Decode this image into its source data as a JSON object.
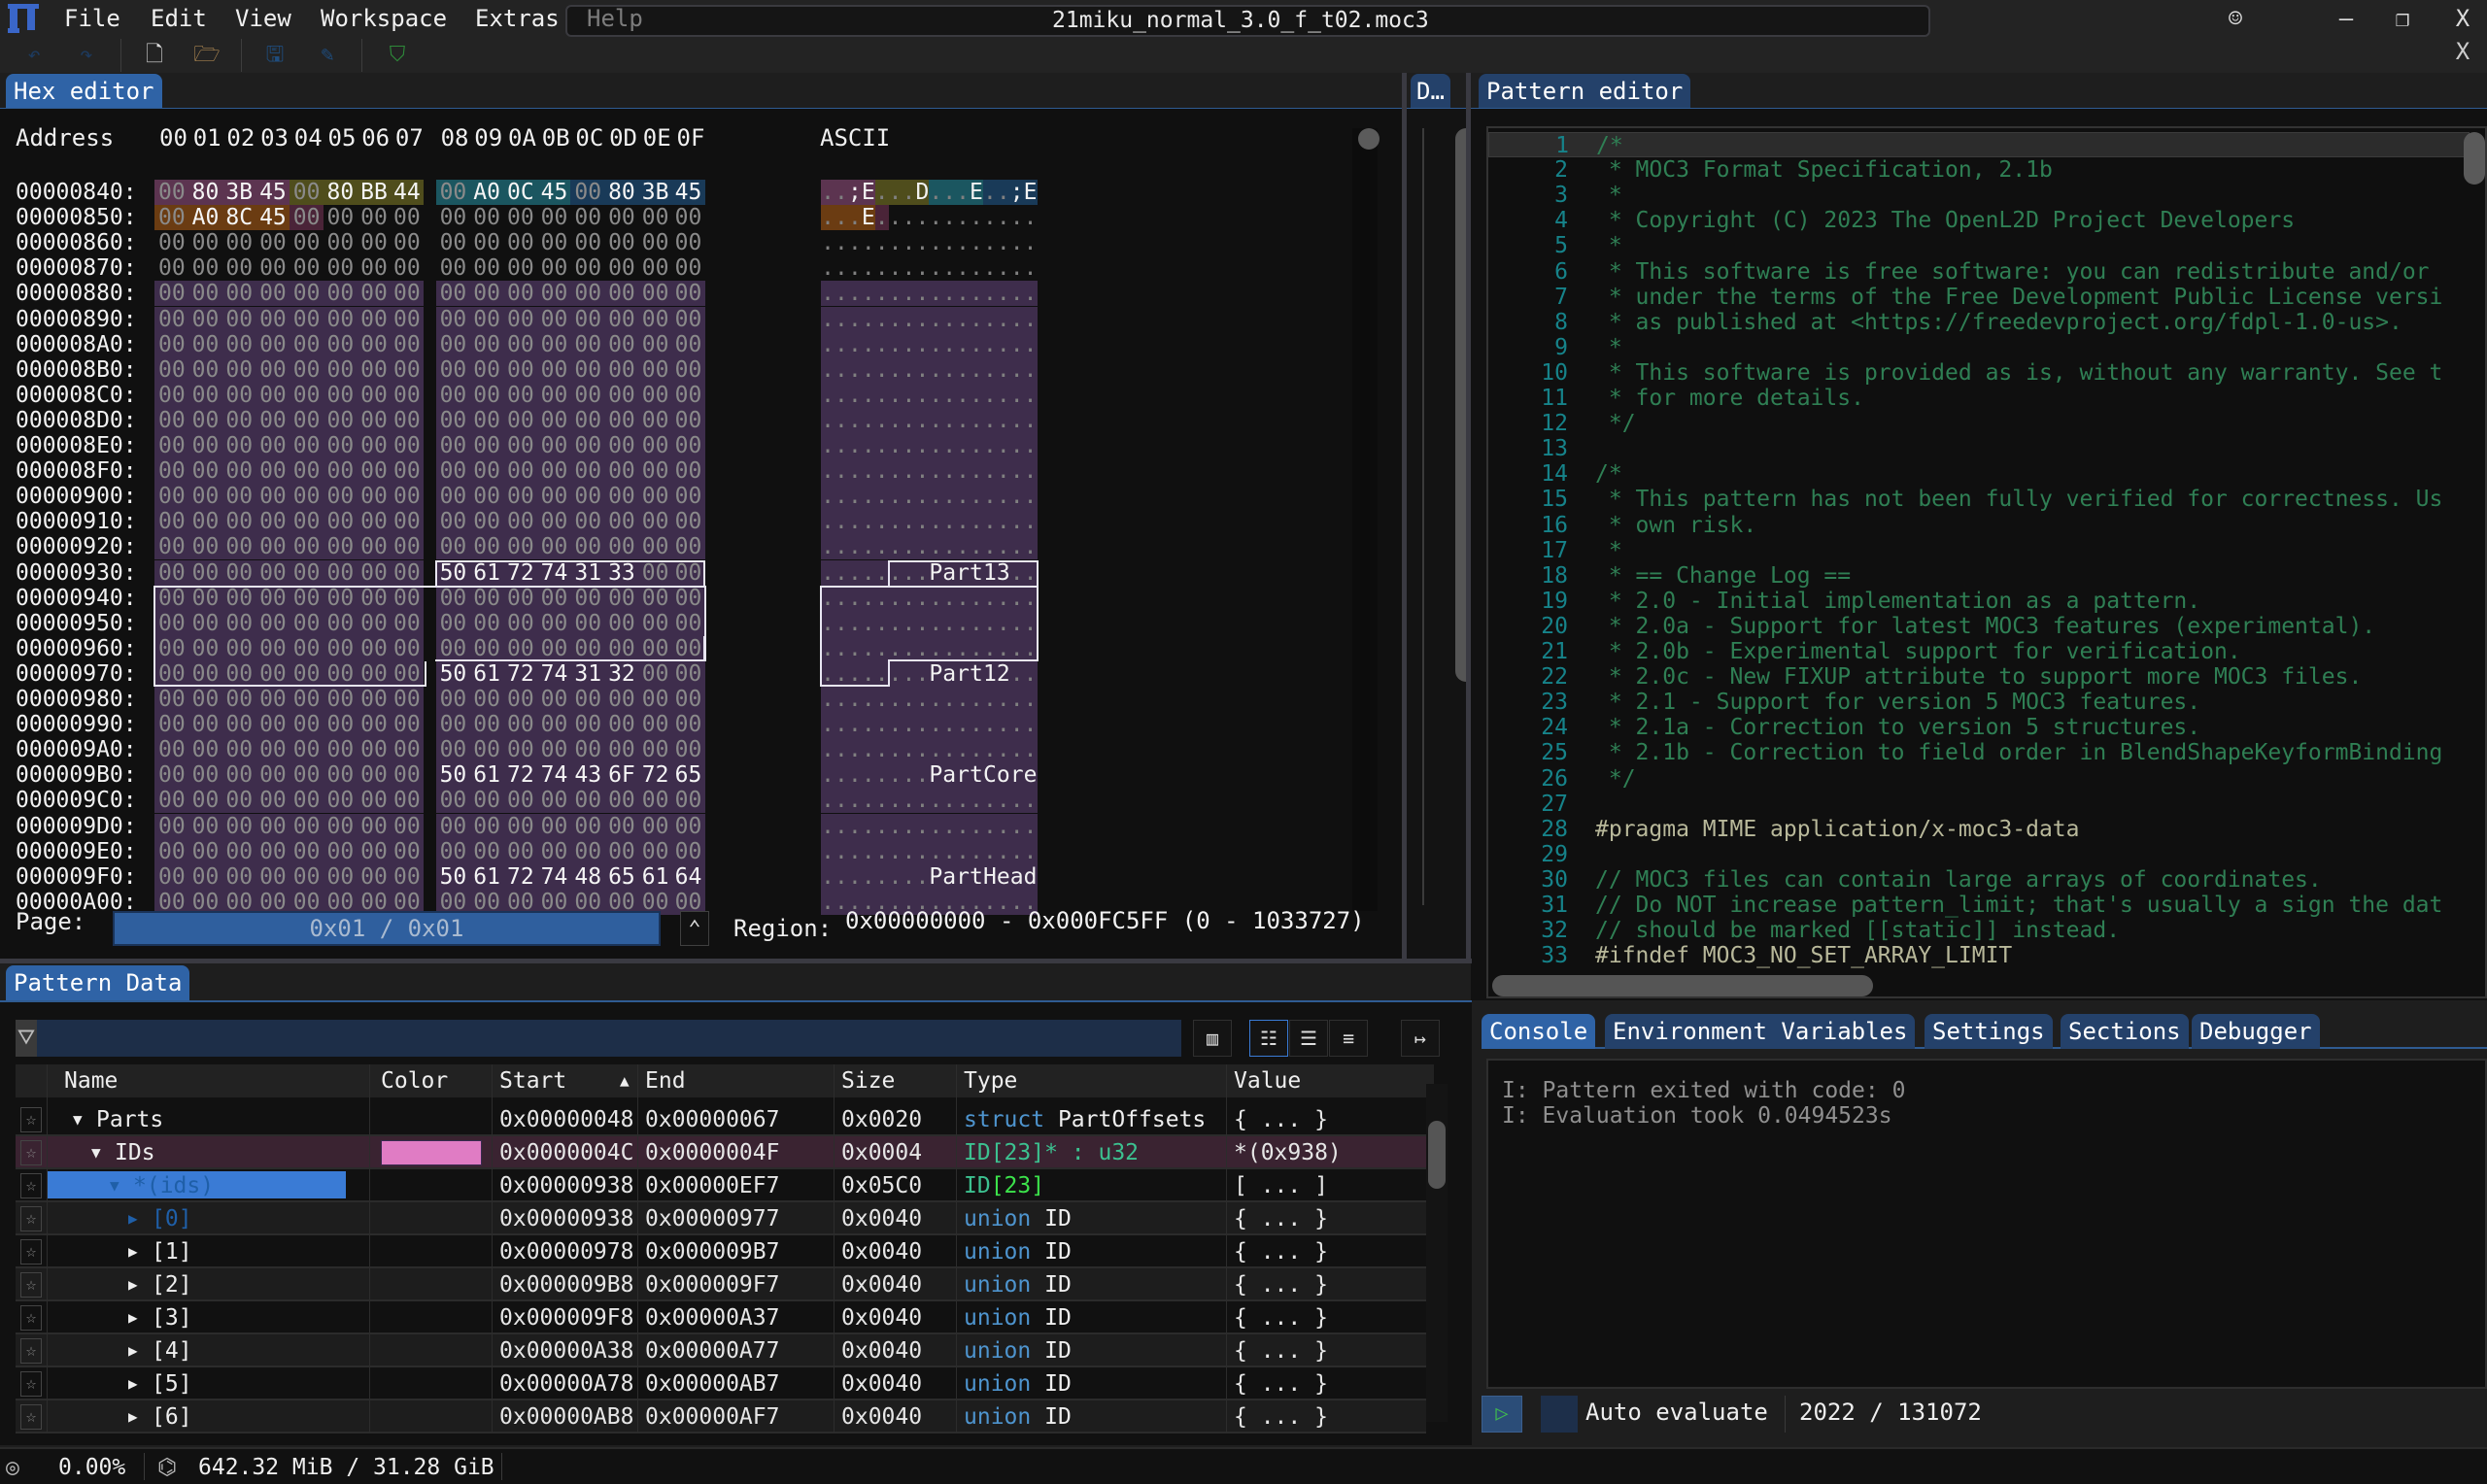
{
  "app": {
    "menu": [
      "File",
      "Edit",
      "View",
      "Workspace",
      "Extras",
      "Help"
    ],
    "file_title": "21miku_normal_3.0_f_t02.moc3",
    "window_buttons": {
      "feedback": "☺",
      "minimize": "–",
      "restore": "❐",
      "close": "X",
      "close_tab": "X"
    }
  },
  "toolbar": {
    "icons": [
      "undo-icon",
      "redo-icon",
      "new-file-icon",
      "open-folder-icon",
      "save-icon",
      "save-as-icon",
      "bookmark-icon"
    ]
  },
  "tabs": {
    "hex_editor": "Hex editor",
    "data_inspector": "D…",
    "pattern_editor": "Pattern editor",
    "pattern_data": "Pattern Data",
    "console_tabs": [
      "Console",
      "Environment Variables",
      "Settings",
      "Sections",
      "Debugger"
    ]
  },
  "hex": {
    "header_address": "Address",
    "header_cols": [
      "00",
      "01",
      "02",
      "03",
      "04",
      "05",
      "06",
      "07",
      "08",
      "09",
      "0A",
      "0B",
      "0C",
      "0D",
      "0E",
      "0F"
    ],
    "header_ascii": "ASCII",
    "rows": [
      {
        "addr": "00000840:",
        "bytes": [
          "00",
          "80",
          "3B",
          "45",
          "00",
          "80",
          "BB",
          "44",
          "00",
          "A0",
          "0C",
          "45",
          "00",
          "80",
          "3B",
          "45"
        ],
        "ascii": "..;E...D...E..;E"
      },
      {
        "addr": "00000850:",
        "bytes": [
          "00",
          "A0",
          "8C",
          "45",
          "00",
          "00",
          "00",
          "00",
          "00",
          "00",
          "00",
          "00",
          "00",
          "00",
          "00",
          "00"
        ],
        "ascii": "...E............"
      },
      {
        "addr": "00000860:",
        "bytes": [
          "00",
          "00",
          "00",
          "00",
          "00",
          "00",
          "00",
          "00",
          "00",
          "00",
          "00",
          "00",
          "00",
          "00",
          "00",
          "00"
        ],
        "ascii": "................"
      },
      {
        "addr": "00000870:",
        "bytes": [
          "00",
          "00",
          "00",
          "00",
          "00",
          "00",
          "00",
          "00",
          "00",
          "00",
          "00",
          "00",
          "00",
          "00",
          "00",
          "00"
        ],
        "ascii": "................"
      },
      {
        "addr": "00000880:",
        "bytes": [
          "00",
          "00",
          "00",
          "00",
          "00",
          "00",
          "00",
          "00",
          "00",
          "00",
          "00",
          "00",
          "00",
          "00",
          "00",
          "00"
        ],
        "ascii": "................"
      },
      {
        "addr": "00000890:",
        "bytes": [
          "00",
          "00",
          "00",
          "00",
          "00",
          "00",
          "00",
          "00",
          "00",
          "00",
          "00",
          "00",
          "00",
          "00",
          "00",
          "00"
        ],
        "ascii": "................"
      },
      {
        "addr": "000008A0:",
        "bytes": [
          "00",
          "00",
          "00",
          "00",
          "00",
          "00",
          "00",
          "00",
          "00",
          "00",
          "00",
          "00",
          "00",
          "00",
          "00",
          "00"
        ],
        "ascii": "................"
      },
      {
        "addr": "000008B0:",
        "bytes": [
          "00",
          "00",
          "00",
          "00",
          "00",
          "00",
          "00",
          "00",
          "00",
          "00",
          "00",
          "00",
          "00",
          "00",
          "00",
          "00"
        ],
        "ascii": "................"
      },
      {
        "addr": "000008C0:",
        "bytes": [
          "00",
          "00",
          "00",
          "00",
          "00",
          "00",
          "00",
          "00",
          "00",
          "00",
          "00",
          "00",
          "00",
          "00",
          "00",
          "00"
        ],
        "ascii": "................"
      },
      {
        "addr": "000008D0:",
        "bytes": [
          "00",
          "00",
          "00",
          "00",
          "00",
          "00",
          "00",
          "00",
          "00",
          "00",
          "00",
          "00",
          "00",
          "00",
          "00",
          "00"
        ],
        "ascii": "................"
      },
      {
        "addr": "000008E0:",
        "bytes": [
          "00",
          "00",
          "00",
          "00",
          "00",
          "00",
          "00",
          "00",
          "00",
          "00",
          "00",
          "00",
          "00",
          "00",
          "00",
          "00"
        ],
        "ascii": "................"
      },
      {
        "addr": "000008F0:",
        "bytes": [
          "00",
          "00",
          "00",
          "00",
          "00",
          "00",
          "00",
          "00",
          "00",
          "00",
          "00",
          "00",
          "00",
          "00",
          "00",
          "00"
        ],
        "ascii": "................"
      },
      {
        "addr": "00000900:",
        "bytes": [
          "00",
          "00",
          "00",
          "00",
          "00",
          "00",
          "00",
          "00",
          "00",
          "00",
          "00",
          "00",
          "00",
          "00",
          "00",
          "00"
        ],
        "ascii": "................"
      },
      {
        "addr": "00000910:",
        "bytes": [
          "00",
          "00",
          "00",
          "00",
          "00",
          "00",
          "00",
          "00",
          "00",
          "00",
          "00",
          "00",
          "00",
          "00",
          "00",
          "00"
        ],
        "ascii": "................"
      },
      {
        "addr": "00000920:",
        "bytes": [
          "00",
          "00",
          "00",
          "00",
          "00",
          "00",
          "00",
          "00",
          "00",
          "00",
          "00",
          "00",
          "00",
          "00",
          "00",
          "00"
        ],
        "ascii": "................"
      },
      {
        "addr": "00000930:",
        "bytes": [
          "00",
          "00",
          "00",
          "00",
          "00",
          "00",
          "00",
          "00",
          "50",
          "61",
          "72",
          "74",
          "31",
          "33",
          "00",
          "00"
        ],
        "ascii": "........Part13.."
      },
      {
        "addr": "00000940:",
        "bytes": [
          "00",
          "00",
          "00",
          "00",
          "00",
          "00",
          "00",
          "00",
          "00",
          "00",
          "00",
          "00",
          "00",
          "00",
          "00",
          "00"
        ],
        "ascii": "................"
      },
      {
        "addr": "00000950:",
        "bytes": [
          "00",
          "00",
          "00",
          "00",
          "00",
          "00",
          "00",
          "00",
          "00",
          "00",
          "00",
          "00",
          "00",
          "00",
          "00",
          "00"
        ],
        "ascii": "................"
      },
      {
        "addr": "00000960:",
        "bytes": [
          "00",
          "00",
          "00",
          "00",
          "00",
          "00",
          "00",
          "00",
          "00",
          "00",
          "00",
          "00",
          "00",
          "00",
          "00",
          "00"
        ],
        "ascii": "................"
      },
      {
        "addr": "00000970:",
        "bytes": [
          "00",
          "00",
          "00",
          "00",
          "00",
          "00",
          "00",
          "00",
          "50",
          "61",
          "72",
          "74",
          "31",
          "32",
          "00",
          "00"
        ],
        "ascii": "........Part12.."
      },
      {
        "addr": "00000980:",
        "bytes": [
          "00",
          "00",
          "00",
          "00",
          "00",
          "00",
          "00",
          "00",
          "00",
          "00",
          "00",
          "00",
          "00",
          "00",
          "00",
          "00"
        ],
        "ascii": "................"
      },
      {
        "addr": "00000990:",
        "bytes": [
          "00",
          "00",
          "00",
          "00",
          "00",
          "00",
          "00",
          "00",
          "00",
          "00",
          "00",
          "00",
          "00",
          "00",
          "00",
          "00"
        ],
        "ascii": "................"
      },
      {
        "addr": "000009A0:",
        "bytes": [
          "00",
          "00",
          "00",
          "00",
          "00",
          "00",
          "00",
          "00",
          "00",
          "00",
          "00",
          "00",
          "00",
          "00",
          "00",
          "00"
        ],
        "ascii": "................"
      },
      {
        "addr": "000009B0:",
        "bytes": [
          "00",
          "00",
          "00",
          "00",
          "00",
          "00",
          "00",
          "00",
          "50",
          "61",
          "72",
          "74",
          "43",
          "6F",
          "72",
          "65"
        ],
        "ascii": "........PartCore"
      },
      {
        "addr": "000009C0:",
        "bytes": [
          "00",
          "00",
          "00",
          "00",
          "00",
          "00",
          "00",
          "00",
          "00",
          "00",
          "00",
          "00",
          "00",
          "00",
          "00",
          "00"
        ],
        "ascii": "................"
      },
      {
        "addr": "000009D0:",
        "bytes": [
          "00",
          "00",
          "00",
          "00",
          "00",
          "00",
          "00",
          "00",
          "00",
          "00",
          "00",
          "00",
          "00",
          "00",
          "00",
          "00"
        ],
        "ascii": "................"
      },
      {
        "addr": "000009E0:",
        "bytes": [
          "00",
          "00",
          "00",
          "00",
          "00",
          "00",
          "00",
          "00",
          "00",
          "00",
          "00",
          "00",
          "00",
          "00",
          "00",
          "00"
        ],
        "ascii": "................"
      },
      {
        "addr": "000009F0:",
        "bytes": [
          "00",
          "00",
          "00",
          "00",
          "00",
          "00",
          "00",
          "00",
          "50",
          "61",
          "72",
          "74",
          "48",
          "65",
          "61",
          "64"
        ],
        "ascii": "........PartHead"
      },
      {
        "addr": "00000A00:",
        "bytes": [
          "00",
          "00",
          "00",
          "00",
          "00",
          "00",
          "00",
          "00",
          "00",
          "00",
          "00",
          "00",
          "00",
          "00",
          "00",
          "00"
        ],
        "ascii": "................"
      }
    ],
    "highlight_colors": {
      "pink": "#5c3450",
      "olive": "#4f4d1c",
      "teal": "#1b5660",
      "navy": "#193a58",
      "orange": "#6b3c12",
      "maroon": "#4a2438",
      "purple": "#3e2d4c"
    },
    "page_label": "Page:",
    "page_value": "0x01 / 0x01",
    "region_label": "Region:",
    "region_value": "0x00000000 - 0x000FC5FF (0 - 1033727)"
  },
  "pattern_editor": {
    "lines": [
      {
        "n": "1",
        "t": "/*",
        "c": "comment"
      },
      {
        "n": "2",
        "t": " * MOC3 Format Specification, 2.1b",
        "c": "comment"
      },
      {
        "n": "3",
        "t": " *",
        "c": "comment"
      },
      {
        "n": "4",
        "t": " * Copyright (C) 2023 The OpenL2D Project Developers",
        "c": "comment"
      },
      {
        "n": "5",
        "t": " *",
        "c": "comment"
      },
      {
        "n": "6",
        "t": " * This software is free software: you can redistribute and/or",
        "c": "comment"
      },
      {
        "n": "7",
        "t": " * under the terms of the Free Development Public License versi",
        "c": "comment"
      },
      {
        "n": "8",
        "t": " * as published at <https://freedevproject.org/fdpl-1.0-us>.",
        "c": "comment"
      },
      {
        "n": "9",
        "t": " *",
        "c": "comment"
      },
      {
        "n": "10",
        "t": " * This software is provided as is, without any warranty. See t",
        "c": "comment"
      },
      {
        "n": "11",
        "t": " * for more details.",
        "c": "comment"
      },
      {
        "n": "12",
        "t": " */",
        "c": "comment"
      },
      {
        "n": "13",
        "t": "",
        "c": "comment"
      },
      {
        "n": "14",
        "t": "/*",
        "c": "comment"
      },
      {
        "n": "15",
        "t": " * This pattern has not been fully verified for correctness. Us",
        "c": "comment"
      },
      {
        "n": "16",
        "t": " * own risk.",
        "c": "comment"
      },
      {
        "n": "17",
        "t": " *",
        "c": "comment"
      },
      {
        "n": "18",
        "t": " * == Change Log ==",
        "c": "comment"
      },
      {
        "n": "19",
        "t": " * 2.0 - Initial implementation as a pattern.",
        "c": "comment"
      },
      {
        "n": "20",
        "t": " * 2.0a - Support for latest MOC3 features (experimental).",
        "c": "comment"
      },
      {
        "n": "21",
        "t": " * 2.0b - Experimental support for verification.",
        "c": "comment"
      },
      {
        "n": "22",
        "t": " * 2.0c - New FIXUP attribute to support more MOC3 files.",
        "c": "comment"
      },
      {
        "n": "23",
        "t": " * 2.1 - Support for version 5 MOC3 features.",
        "c": "comment"
      },
      {
        "n": "24",
        "t": " * 2.1a - Correction to version 5 structures.",
        "c": "comment"
      },
      {
        "n": "25",
        "t": " * 2.1b - Correction to field order in BlendShapeKeyformBinding",
        "c": "comment"
      },
      {
        "n": "26",
        "t": " */",
        "c": "comment"
      },
      {
        "n": "27",
        "t": "",
        "c": "comment"
      },
      {
        "n": "28",
        "t": "#pragma MIME application/x-moc3-data",
        "c": "pre"
      },
      {
        "n": "29",
        "t": "",
        "c": "comment"
      },
      {
        "n": "30",
        "t": "// MOC3 files can contain large arrays of coordinates.",
        "c": "comment"
      },
      {
        "n": "31",
        "t": "// Do NOT increase pattern_limit; that's usually a sign the dat",
        "c": "comment"
      },
      {
        "n": "32",
        "t": "// should be marked [[static]] instead.",
        "c": "comment"
      },
      {
        "n": "33",
        "t": "#ifndef MOC3_NO_SET_ARRAY_LIMIT",
        "c": "pre"
      }
    ]
  },
  "console": {
    "lines": [
      "I: Pattern exited with code: 0",
      "I: Evaluation took 0.0494523s"
    ],
    "run_icon": "▷",
    "auto_evaluate_label": "Auto evaluate",
    "auto_evaluate_checked": false,
    "eval_count": "2022 / 131072"
  },
  "pattern_data": {
    "filter_value": "",
    "columns": [
      "Name",
      "Color",
      "Start",
      "End",
      "Size",
      "Type",
      "Value"
    ],
    "sort_indicator": "▲",
    "rows": [
      {
        "indent": 1,
        "expander": "▼",
        "name": "Parts",
        "color": "",
        "start": "0x00000048",
        "end": "0x00000067",
        "size": "0x0020",
        "type_kw": "struct",
        "type_name": "PartOffsets",
        "type_extra": "",
        "value": "{ ... }"
      },
      {
        "indent": 2,
        "expander": "▼",
        "name": "IDs",
        "color": "#e07cc4",
        "start": "0x0000004C",
        "end": "0x0000004F",
        "size": "0x0004",
        "type_kw": "",
        "type_name": "ID[23]* : u32",
        "type_extra": "",
        "value": "*(0x938)"
      },
      {
        "indent": 3,
        "expander": "▼",
        "name": "*(ids)",
        "color": "",
        "start": "0x00000938",
        "end": "0x00000EF7",
        "size": "0x05C0",
        "type_kw": "",
        "type_name": "ID",
        "type_extra": "[23]",
        "value": "[ ... ]"
      },
      {
        "indent": 4,
        "expander": "▶",
        "name": "[0]",
        "color": "",
        "start": "0x00000938",
        "end": "0x00000977",
        "size": "0x0040",
        "type_kw": "union",
        "type_name": "ID",
        "type_extra": "",
        "value": "{ ... }"
      },
      {
        "indent": 4,
        "expander": "▶",
        "name": "[1]",
        "color": "",
        "start": "0x00000978",
        "end": "0x000009B7",
        "size": "0x0040",
        "type_kw": "union",
        "type_name": "ID",
        "type_extra": "",
        "value": "{ ... }"
      },
      {
        "indent": 4,
        "expander": "▶",
        "name": "[2]",
        "color": "",
        "start": "0x000009B8",
        "end": "0x000009F7",
        "size": "0x0040",
        "type_kw": "union",
        "type_name": "ID",
        "type_extra": "",
        "value": "{ ... }"
      },
      {
        "indent": 4,
        "expander": "▶",
        "name": "[3]",
        "color": "",
        "start": "0x000009F8",
        "end": "0x00000A37",
        "size": "0x0040",
        "type_kw": "union",
        "type_name": "ID",
        "type_extra": "",
        "value": "{ ... }"
      },
      {
        "indent": 4,
        "expander": "▶",
        "name": "[4]",
        "color": "",
        "start": "0x00000A38",
        "end": "0x00000A77",
        "size": "0x0040",
        "type_kw": "union",
        "type_name": "ID",
        "type_extra": "",
        "value": "{ ... }"
      },
      {
        "indent": 4,
        "expander": "▶",
        "name": "[5]",
        "color": "",
        "start": "0x00000A78",
        "end": "0x00000AB7",
        "size": "0x0040",
        "type_kw": "union",
        "type_name": "ID",
        "type_extra": "",
        "value": "{ ... }"
      },
      {
        "indent": 4,
        "expander": "▶",
        "name": "[6]",
        "color": "",
        "start": "0x00000AB8",
        "end": "0x00000AF7",
        "size": "0x0040",
        "type_kw": "union",
        "type_name": "ID",
        "type_extra": "",
        "value": "{ ... }"
      }
    ]
  },
  "status": {
    "cpu_usage": "0.00%",
    "memory": "642.32 MiB / 31.28 GiB"
  }
}
